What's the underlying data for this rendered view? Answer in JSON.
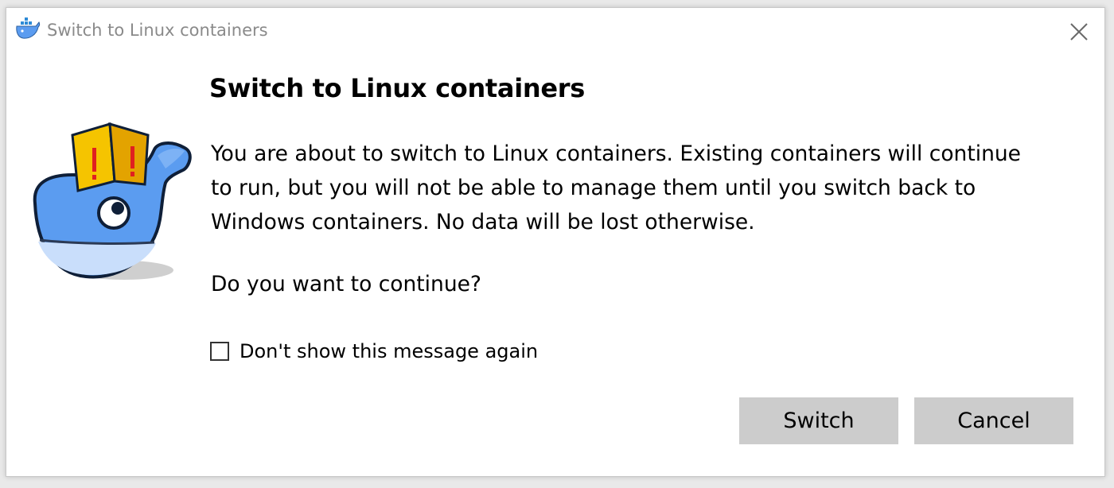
{
  "window": {
    "title": "Switch to Linux containers"
  },
  "dialog": {
    "heading": "Switch to Linux containers",
    "message_lines": [
      "You are about to switch to Linux containers. Existing containers will continue",
      "to run, but you will not be able to manage them until you switch back to",
      "Windows containers. No data will be lost otherwise."
    ],
    "question": "Do you want to continue?",
    "checkbox": {
      "label": "Don't show this message again",
      "checked": false
    },
    "buttons": {
      "switch": "Switch",
      "cancel": "Cancel"
    }
  },
  "icons": {
    "title": "docker-whale-icon",
    "close": "close-icon",
    "illustration": "docker-whale-warning-boxes"
  },
  "colors": {
    "button_bg": "#cccccc",
    "whale_blue": "#5b9cf0",
    "whale_belly": "#c9defb",
    "box_yellow": "#f5c400",
    "box_orange": "#e3a300",
    "exclaim_red": "#e02020"
  }
}
